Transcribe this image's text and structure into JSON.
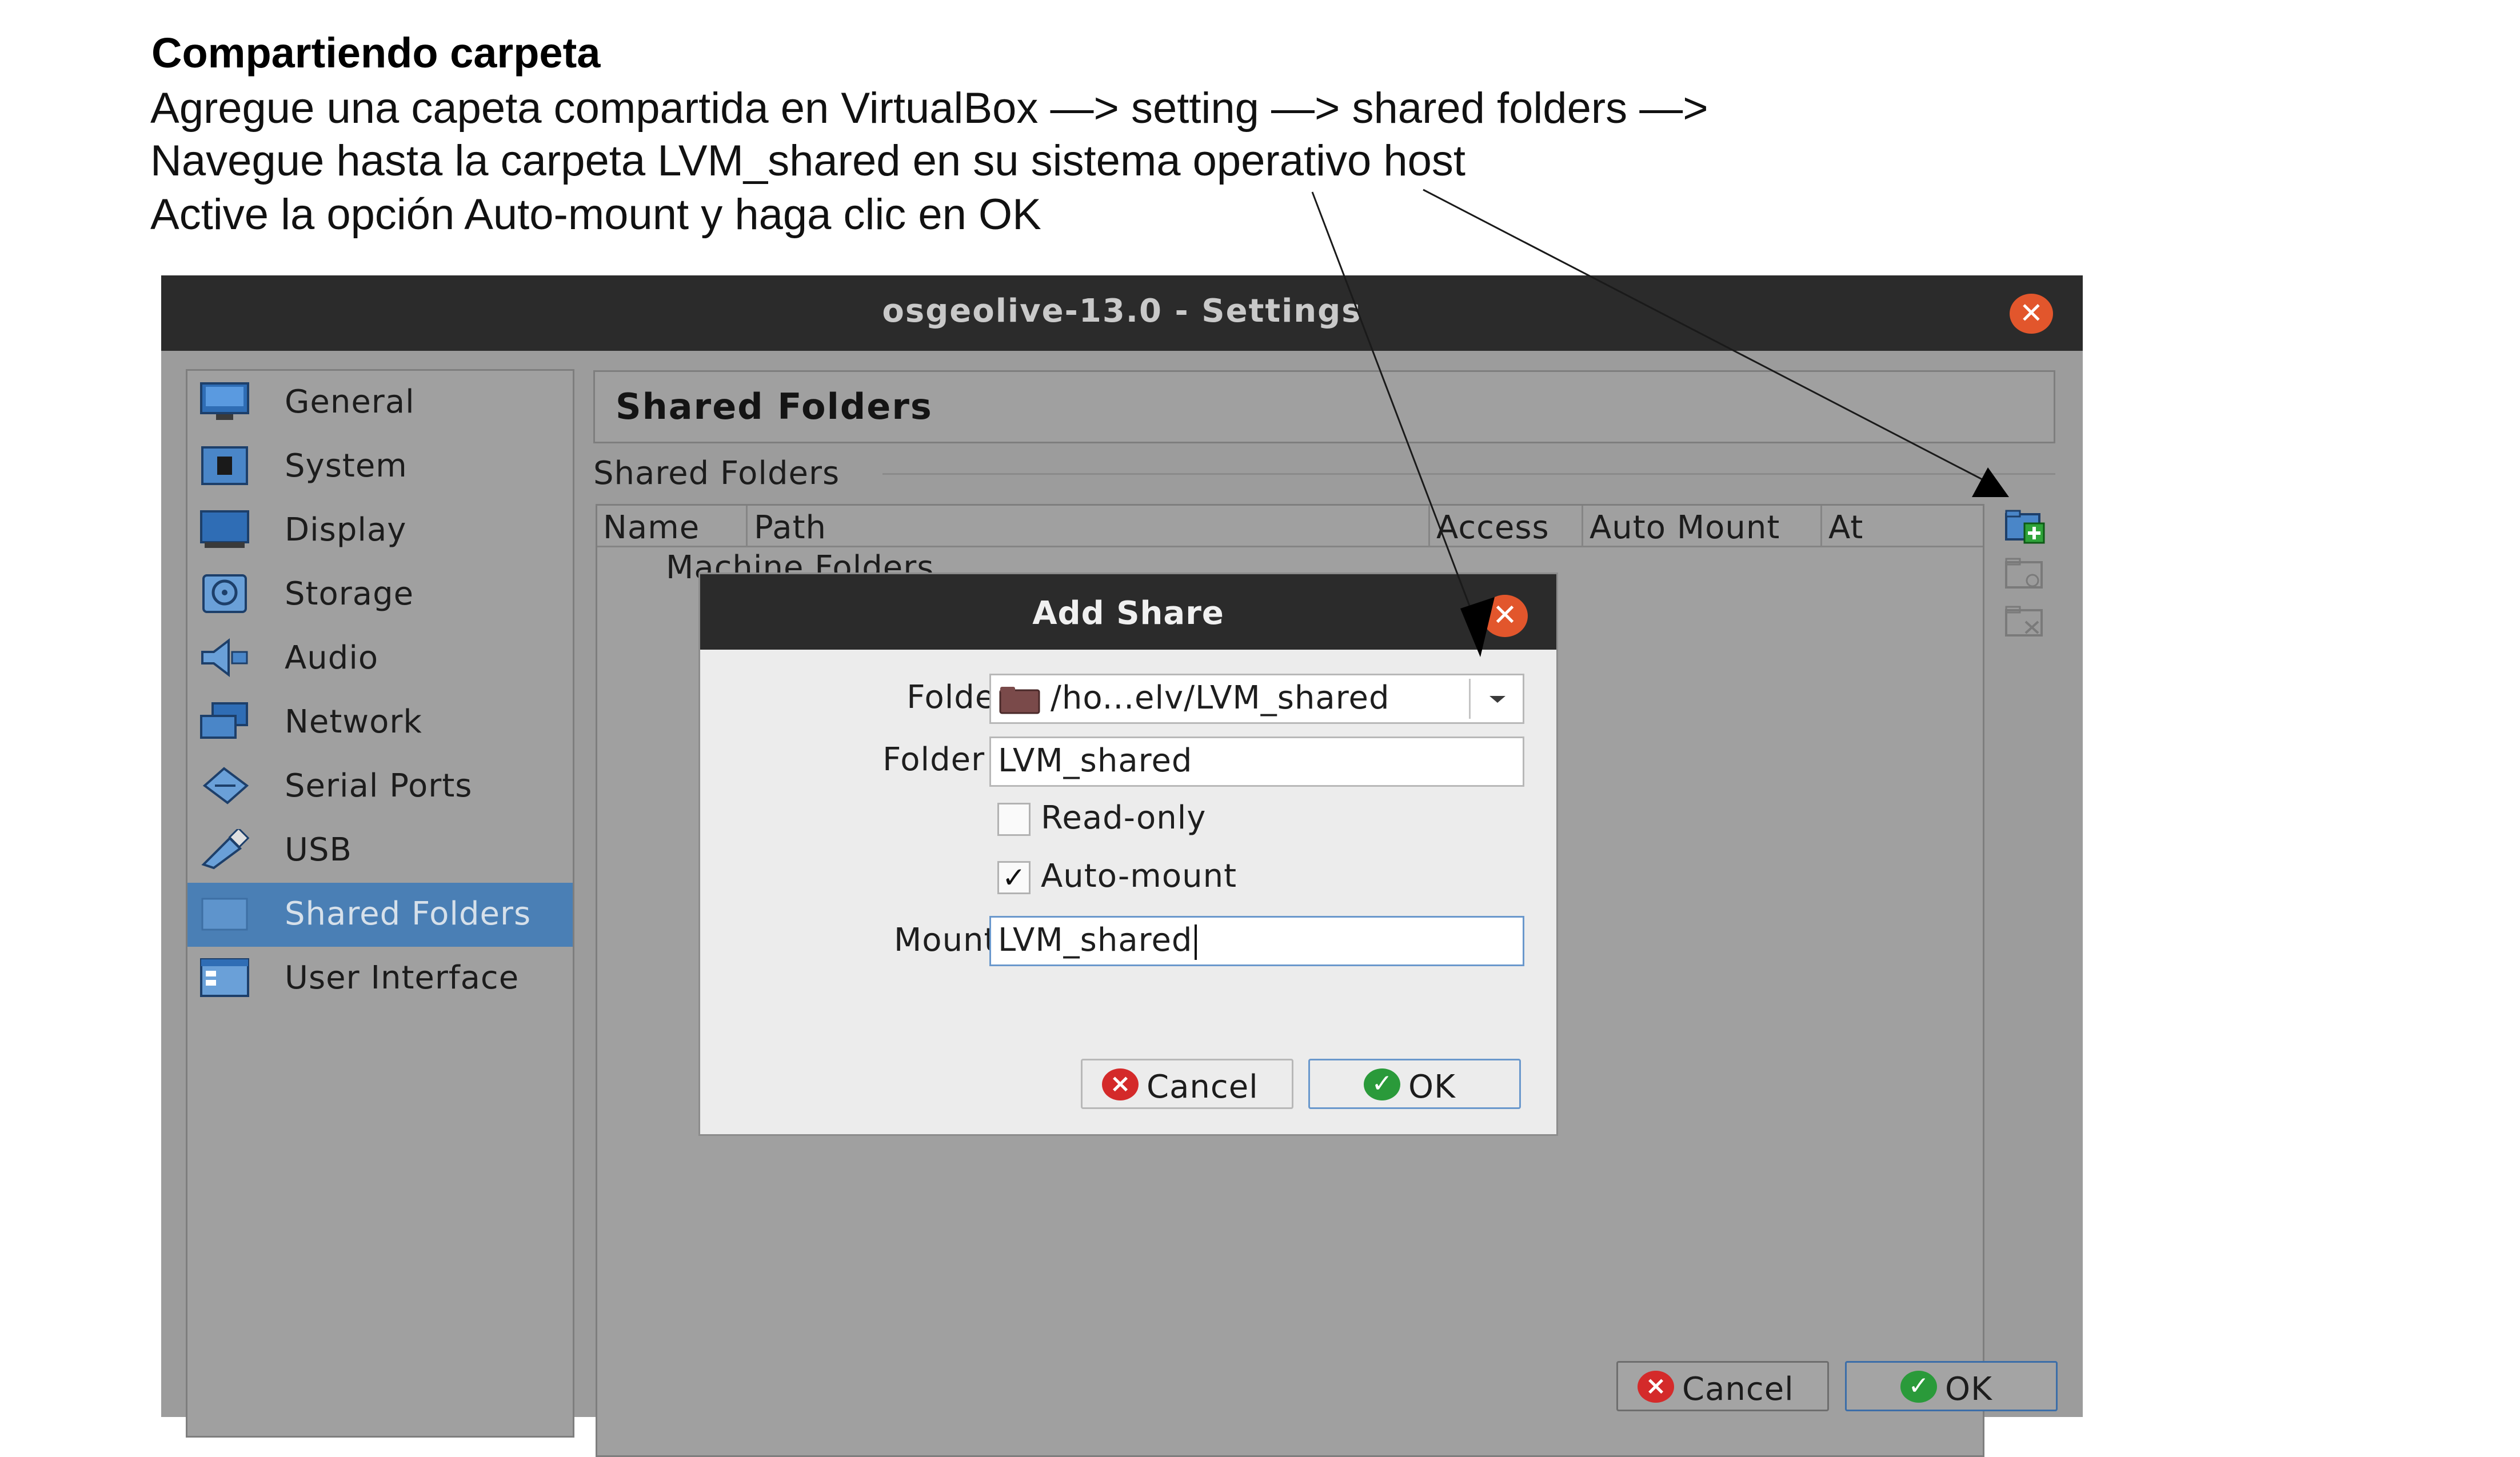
{
  "instructions": {
    "title": "Compartiendo carpeta",
    "lines": [
      "Agregue una capeta compartida en VirtualBox —> setting —> shared folders —>",
      "Navegue hasta la carpeta LVM_shared en su sistema operativo host",
      "Active la opción Auto-mount y haga clic en OK"
    ]
  },
  "window": {
    "title": "osgeolive-13.0 - Settings",
    "close_symbol": "✕"
  },
  "sidebar": {
    "items": [
      {
        "label": "General",
        "icon": "monitor-icon"
      },
      {
        "label": "System",
        "icon": "chip-icon"
      },
      {
        "label": "Display",
        "icon": "display-icon"
      },
      {
        "label": "Storage",
        "icon": "disk-icon"
      },
      {
        "label": "Audio",
        "icon": "speaker-icon"
      },
      {
        "label": "Network",
        "icon": "network-icon"
      },
      {
        "label": "Serial Ports",
        "icon": "serial-port-icon"
      },
      {
        "label": "USB",
        "icon": "usb-icon"
      },
      {
        "label": "Shared Folders",
        "icon": "shared-folder-icon",
        "active": true
      },
      {
        "label": "User Interface",
        "icon": "user-interface-icon"
      }
    ]
  },
  "main": {
    "section_title": "Shared Folders",
    "group_label": "Shared Folders",
    "table": {
      "columns": [
        "Name",
        "Path",
        "Access",
        "Auto Mount",
        "At"
      ],
      "group_row": "Machine Folders"
    },
    "tools": [
      "add-share-icon",
      "edit-share-icon",
      "remove-share-icon"
    ]
  },
  "buttons": {
    "cancel": "Cancel",
    "ok": "OK"
  },
  "dialog": {
    "title": "Add Share",
    "folder_path_label": "Folder Path:",
    "folder_path_value": "/ho...elv/LVM_shared",
    "folder_name_label": "Folder Name:",
    "folder_name_value": "LVM_shared",
    "readonly_label": "Read-only",
    "readonly_checked": false,
    "automount_label": "Auto-mount",
    "automount_checked": true,
    "mount_point_label": "Mount point:",
    "mount_point_value": "LVM_shared",
    "cancel": "Cancel",
    "ok": "OK"
  },
  "colors": {
    "titlebar": "#2b2b2b",
    "window_bg": "#9c9c9c",
    "selection": "#4a7fb5",
    "close_button": "#e2562c",
    "cancel_icon": "#d42a2a",
    "ok_icon": "#2a9a3a"
  }
}
